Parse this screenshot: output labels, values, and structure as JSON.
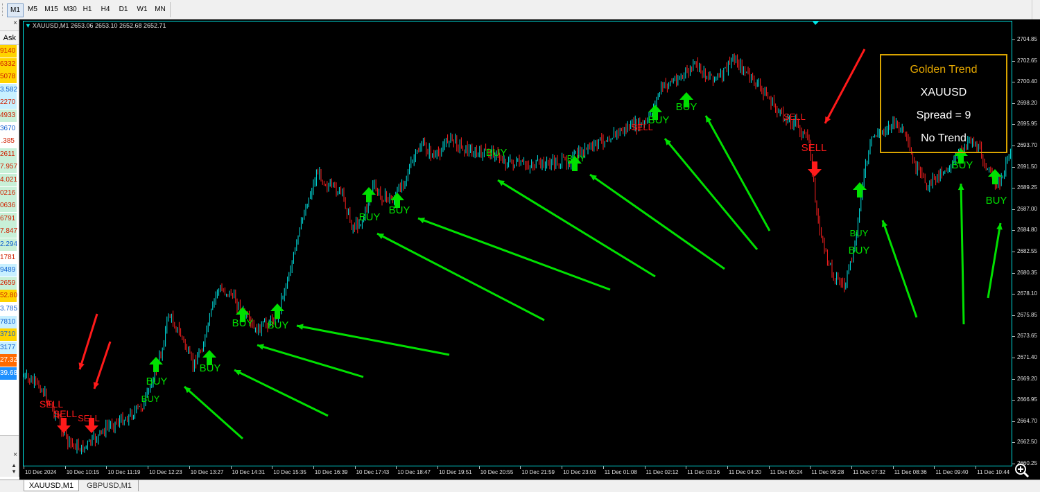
{
  "toolbar": {
    "timeframes": [
      "M1",
      "M5",
      "M15",
      "M30",
      "H1",
      "H4",
      "D1",
      "W1",
      "MN"
    ],
    "active": "M1"
  },
  "market_watch": {
    "close": "×",
    "column": "Ask",
    "cells": [
      {
        "v": "9140",
        "bg": "#ffd400",
        "c": "#d02000"
      },
      {
        "v": "6332",
        "bg": "#ffd400",
        "c": "#d02000"
      },
      {
        "v": "5078",
        "bg": "#ffd400",
        "c": "#d02000"
      },
      {
        "v": "3.582",
        "bg": "#c8f0ff",
        "c": "#1060d0"
      },
      {
        "v": "2270",
        "bg": "#c8f0ff",
        "c": "#d02000"
      },
      {
        "v": "4933",
        "bg": "#c8f0d8",
        "c": "#d02000"
      },
      {
        "v": "3670",
        "bg": "#ffffff",
        "c": "#1060d0"
      },
      {
        "v": ".385",
        "bg": "#ffffff",
        "c": "#d02000"
      },
      {
        "v": "2611",
        "bg": "#c8f0d8",
        "c": "#d02000"
      },
      {
        "v": "7.957",
        "bg": "#c8f0d8",
        "c": "#d02000"
      },
      {
        "v": "4.021",
        "bg": "#c8f0d8",
        "c": "#d02000"
      },
      {
        "v": "0216",
        "bg": "#c8f0d8",
        "c": "#d02000"
      },
      {
        "v": "0636",
        "bg": "#c8f0d8",
        "c": "#d02000"
      },
      {
        "v": "6791",
        "bg": "#c8f0d8",
        "c": "#d02000"
      },
      {
        "v": "7.847",
        "bg": "#c8f0d8",
        "c": "#d02000"
      },
      {
        "v": "2.294",
        "bg": "#c8f0d8",
        "c": "#1060d0"
      },
      {
        "v": "1781",
        "bg": "#ffffff",
        "c": "#d02000"
      },
      {
        "v": "9489",
        "bg": "#c8f0ff",
        "c": "#1060d0"
      },
      {
        "v": "2659",
        "bg": "#c8f0d8",
        "c": "#d02000"
      },
      {
        "v": "52.80",
        "bg": "#ffd400",
        "c": "#d02000"
      },
      {
        "v": "3.785",
        "bg": "#ffffff",
        "c": "#1060d0"
      },
      {
        "v": "7810",
        "bg": "#c8f0ff",
        "c": "#1060d0"
      },
      {
        "v": "3710",
        "bg": "#ffd400",
        "c": "#1060d0"
      },
      {
        "v": "3177",
        "bg": "#c8f0ff",
        "c": "#1060d0"
      },
      {
        "v": "27.32",
        "bg": "#ff6a00",
        "c": "#ffffff"
      },
      {
        "v": "39.68",
        "bg": "#1e90ff",
        "c": "#ffffff"
      }
    ],
    "bottom_close": "×",
    "scroll_up": "▲",
    "scroll_down": "▼"
  },
  "chart": {
    "symbol_info": "XAUUSD,M1  2653.06 2653.10 2652.68 2652.71",
    "y_labels": [
      "2704.85",
      "2702.65",
      "2700.40",
      "2698.20",
      "2695.95",
      "2693.70",
      "2691.50",
      "2689.25",
      "2687.00",
      "2684.80",
      "2682.55",
      "2680.35",
      "2678.10",
      "2675.85",
      "2673.65",
      "2671.40",
      "2669.20",
      "2666.95",
      "2664.70",
      "2662.50",
      "2660.25"
    ],
    "x_labels": [
      "10 Dec 2024",
      "10 Dec 10:15",
      "10 Dec 11:19",
      "10 Dec 12:23",
      "10 Dec 13:27",
      "10 Dec 14:31",
      "10 Dec 15:35",
      "10 Dec 16:39",
      "10 Dec 17:43",
      "10 Dec 18:47",
      "10 Dec 19:51",
      "10 Dec 20:55",
      "10 Dec 21:59",
      "10 Dec 23:03",
      "11 Dec 01:08",
      "11 Dec 02:12",
      "11 Dec 03:16",
      "11 Dec 04:20",
      "11 Dec 05:24",
      "11 Dec 06:28",
      "11 Dec 07:32",
      "11 Dec 08:36",
      "11 Dec 09:40",
      "11 Dec 10:44"
    ],
    "signal_buy": "BUY",
    "signal_sell": "SELL",
    "colors": {
      "bg": "#000000",
      "up": "#00e5e5",
      "down": "#ff2020",
      "buy": "#00e000",
      "sell": "#ff1a1a",
      "axis": "#00e5e5"
    }
  },
  "info_panel": {
    "title": "Golden Trend",
    "symbol": "XAUUSD",
    "spread": "Spread = 9",
    "trend": "No Trend",
    "border_color": "#d9a400"
  },
  "tabs": [
    "XAUUSD,M1",
    "GBPUSD,M1"
  ]
}
